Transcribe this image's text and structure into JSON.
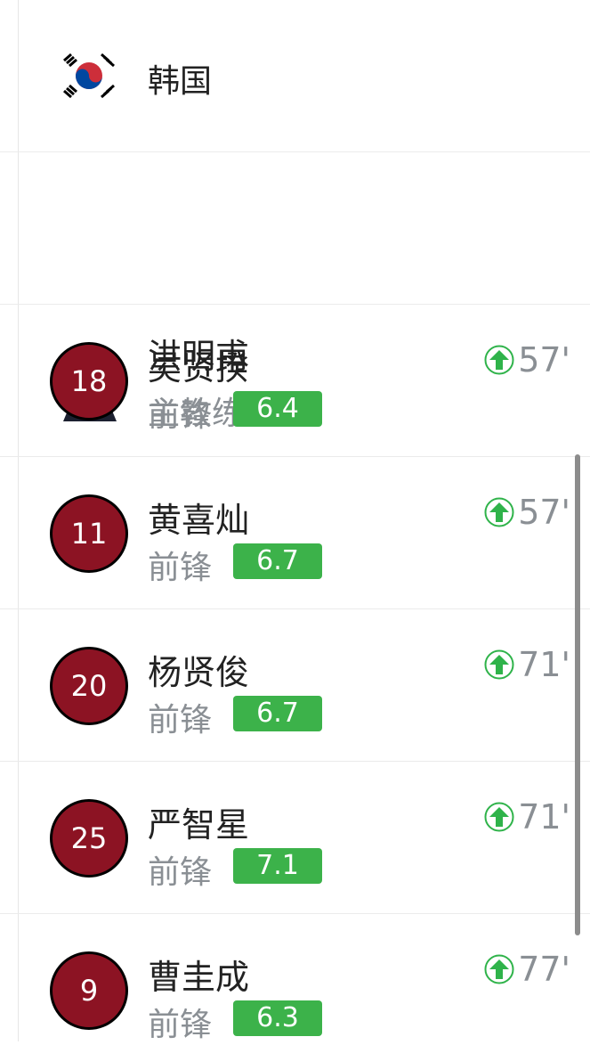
{
  "team": {
    "name": "韩国"
  },
  "coach": {
    "name": "洪明甫",
    "role": "主教练"
  },
  "players": [
    {
      "number": "18",
      "name": "吴贤揆",
      "position": "前锋",
      "rating": "6.4",
      "sub_minute": "57'"
    },
    {
      "number": "11",
      "name": "黄喜灿",
      "position": "前锋",
      "rating": "6.7",
      "sub_minute": "57'"
    },
    {
      "number": "20",
      "name": "杨贤俊",
      "position": "前锋",
      "rating": "6.7",
      "sub_minute": "71'"
    },
    {
      "number": "25",
      "name": "严智星",
      "position": "前锋",
      "rating": "7.1",
      "sub_minute": "71'"
    },
    {
      "number": "9",
      "name": "曹圭成",
      "position": "前锋",
      "rating": "6.3",
      "sub_minute": "77'"
    }
  ],
  "colors": {
    "jersey": "#8c1323",
    "rating_bg": "#3cb24a",
    "sub_in": "#2fb34a"
  },
  "icons": {
    "substitution": "arrow-up-circle-icon",
    "flag": "south-korea-flag-icon"
  }
}
